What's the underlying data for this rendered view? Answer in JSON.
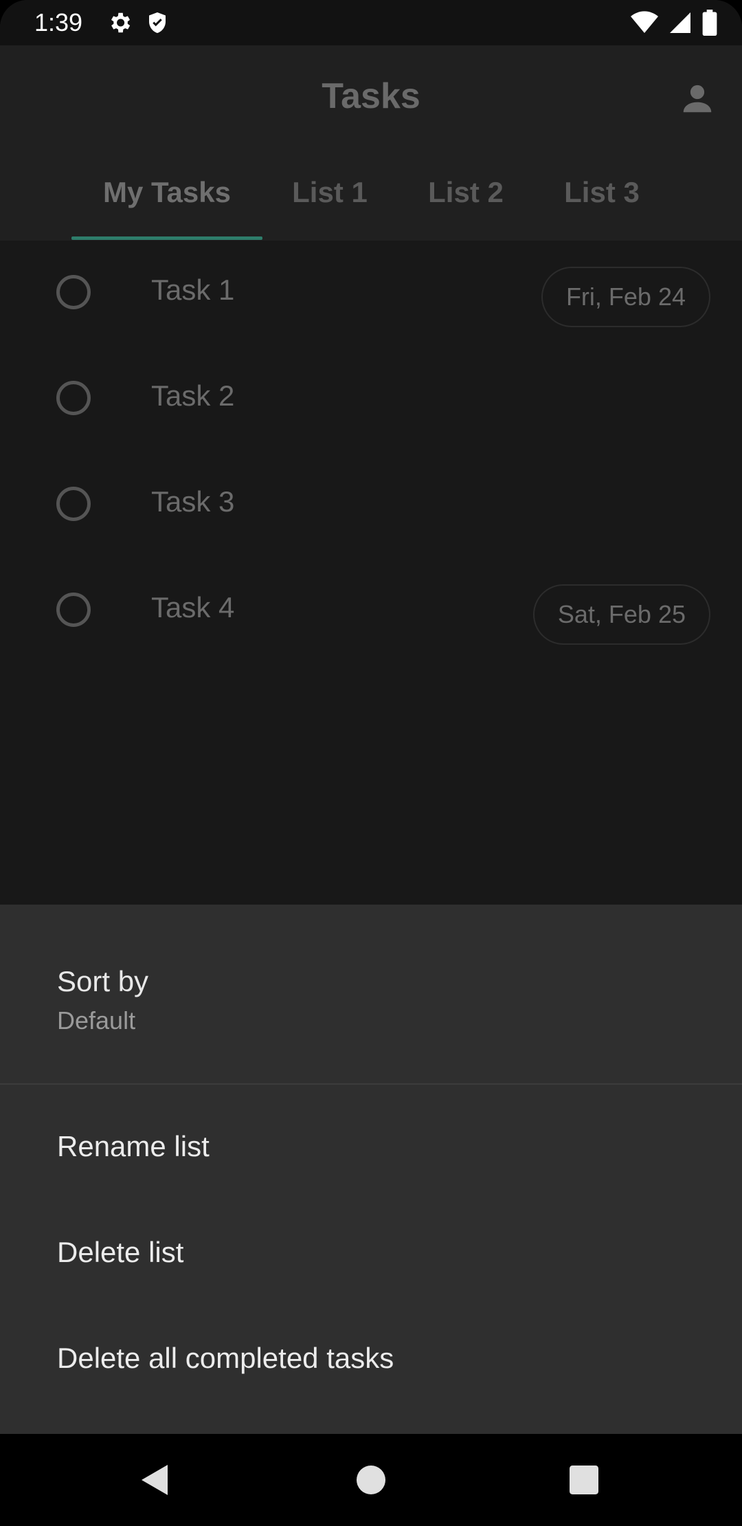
{
  "status_bar": {
    "time": "1:39",
    "left_icons": [
      "gear-icon",
      "shield-icon"
    ],
    "right_icons": [
      "wifi-icon",
      "signal-icon",
      "battery-icon"
    ]
  },
  "app_bar": {
    "title": "Tasks",
    "account_icon": "account-icon"
  },
  "tabs": [
    {
      "label": "My Tasks",
      "active": true
    },
    {
      "label": "List 1",
      "active": false
    },
    {
      "label": "List 2",
      "active": false
    },
    {
      "label": "List 3",
      "active": false
    }
  ],
  "tasks": [
    {
      "label": "Task 1",
      "due": "Fri, Feb 24"
    },
    {
      "label": "Task 2",
      "due": ""
    },
    {
      "label": "Task 3",
      "due": ""
    },
    {
      "label": "Task 4",
      "due": "Sat, Feb 25"
    }
  ],
  "sheet": {
    "sort_title": "Sort by",
    "sort_value": "Default",
    "items": [
      {
        "label": "Rename list"
      },
      {
        "label": "Delete list"
      },
      {
        "label": "Delete all completed tasks"
      }
    ]
  },
  "nav_bar": {
    "buttons": [
      "back-icon",
      "home-icon",
      "recents-icon"
    ]
  },
  "colors": {
    "accent": "#2e7d6b",
    "sheet_bg": "#2f2f2f",
    "app_bar_bg": "#202020"
  }
}
